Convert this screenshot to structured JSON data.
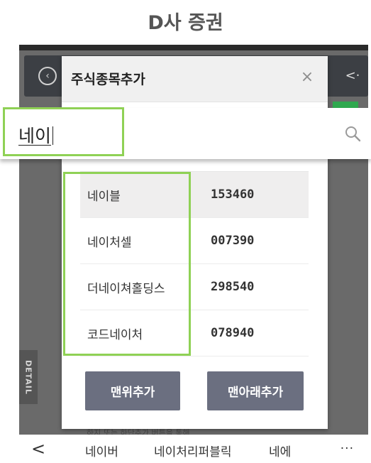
{
  "header": {
    "title": "D사 증권"
  },
  "phone": {
    "side_tab_label": "DETAIL",
    "bottom_peek_text": "하지 또는 하단추가 버튼을 통해"
  },
  "modal": {
    "title": "주식종목추가",
    "close_label": "×",
    "results": [
      {
        "name": "네이블",
        "code": "153460",
        "selected": true
      },
      {
        "name": "네이처셀",
        "code": "007390",
        "selected": false
      },
      {
        "name": "더네이쳐홀딩스",
        "code": "298540",
        "selected": false
      },
      {
        "name": "코드네이처",
        "code": "078940",
        "selected": false
      }
    ],
    "add_top_label": "맨위추가",
    "add_bottom_label": "맨아래추가"
  },
  "search": {
    "value": "네이",
    "icon": "search-icon"
  },
  "bottom_nav": {
    "back_label": "<",
    "items": [
      "네이버",
      "네이처리퍼블릭",
      "네에"
    ],
    "more_label": "···"
  },
  "colors": {
    "highlight": "#8fd155",
    "button": "#6b6f80",
    "accent_green": "#2fa84f"
  }
}
